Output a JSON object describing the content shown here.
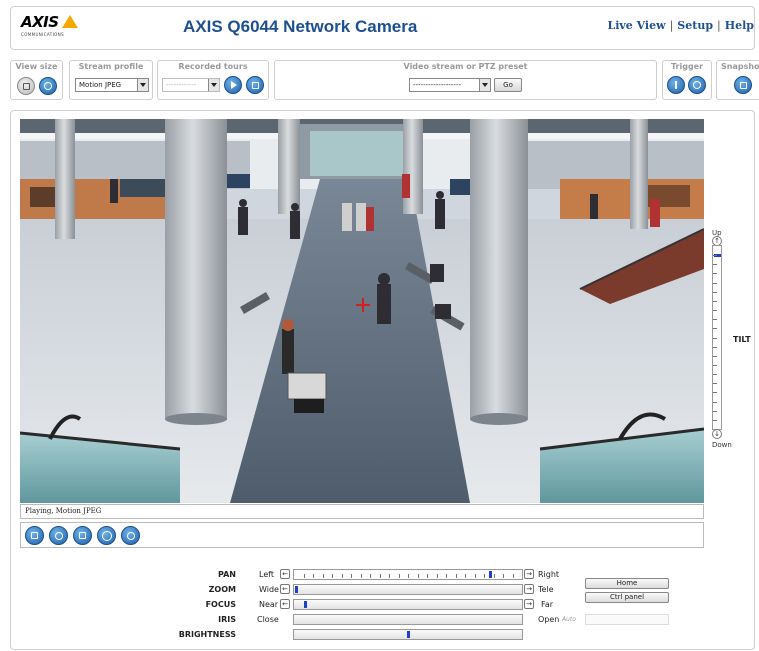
{
  "header": {
    "logo_text": "AXIS",
    "logo_sub": "COMMUNICATIONS",
    "title": "AXIS Q6044 Network Camera",
    "nav": {
      "live_view": "Live View",
      "setup": "Setup",
      "help": "Help",
      "separator": "|"
    }
  },
  "toolbar": {
    "view_size": {
      "label": "View size"
    },
    "stream_profile": {
      "label": "Stream profile",
      "value": "Motion JPEG"
    },
    "recorded_tours": {
      "label": "Recorded tours",
      "value": "------------"
    },
    "preset": {
      "label": "Video stream or PTZ preset",
      "value": "-------------------",
      "go_label": "Go"
    },
    "trigger": {
      "label": "Trigger"
    },
    "snapshot": {
      "label": "Snapshot"
    }
  },
  "video": {
    "status_text": "Playing, Motion JPEG"
  },
  "tilt": {
    "label": "TILT",
    "up_label": "Up",
    "down_label": "Down",
    "position": 0.04
  },
  "ptz": {
    "pan": {
      "label": "PAN",
      "left": "Left",
      "right": "Right",
      "position": 0.87
    },
    "zoom": {
      "label": "ZOOM",
      "left": "Wide",
      "right": "Tele",
      "position": 0.0
    },
    "focus": {
      "label": "FOCUS",
      "left": "Near",
      "right": "Far",
      "position": 0.04
    },
    "iris": {
      "label": "IRIS",
      "left": "Close",
      "right": "Open",
      "auto_label": "Auto"
    },
    "brightness": {
      "label": "BRIGHTNESS",
      "position": 0.5
    },
    "home_label": "Home",
    "ctrl_panel_label": "Ctrl panel"
  },
  "colors": {
    "accent": "#1d4f91",
    "slider_thumb": "#1c3fcf",
    "logo_triangle": "#f6a800"
  },
  "icons": {
    "view_size": [
      "fullsize-icon",
      "fit-window-icon"
    ],
    "recorded_tours": [
      "play-icon",
      "stop-icon"
    ],
    "trigger": [
      "trigger-on-icon",
      "trigger-off-icon"
    ],
    "snapshot": [
      "camera-icon"
    ],
    "control_bar": [
      "stop-icon",
      "snapshot-icon",
      "fullscreen-icon",
      "ptz-emulation-icon",
      "record-icon"
    ]
  }
}
